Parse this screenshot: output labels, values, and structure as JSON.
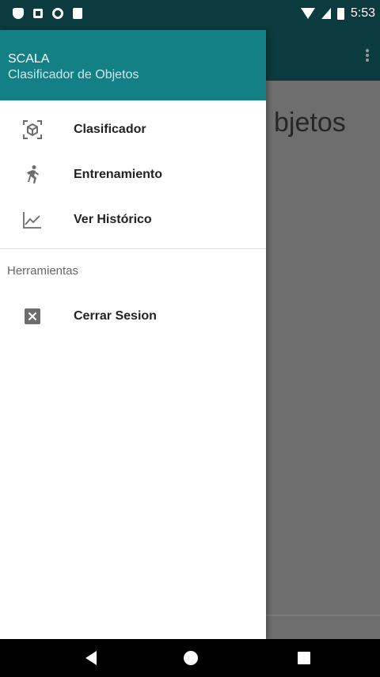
{
  "status_bar": {
    "time": "5:53"
  },
  "background": {
    "title_fragment": "bjetos"
  },
  "drawer": {
    "header": {
      "title": "SCALA",
      "subtitle": "Clasificador de Objetos"
    },
    "items": [
      {
        "label": "Clasificador",
        "icon": "cube-scan-icon"
      },
      {
        "label": "Entrenamiento",
        "icon": "running-figure-icon"
      },
      {
        "label": "Ver Histórico",
        "icon": "line-chart-icon"
      }
    ],
    "section_label": "Herramientas",
    "tools": [
      {
        "label": "Cerrar Sesion",
        "icon": "close-box-icon"
      }
    ]
  },
  "colors": {
    "primary": "#138086",
    "primary_dark": "#0b3b3e",
    "scrim": "#6e6e6e"
  }
}
